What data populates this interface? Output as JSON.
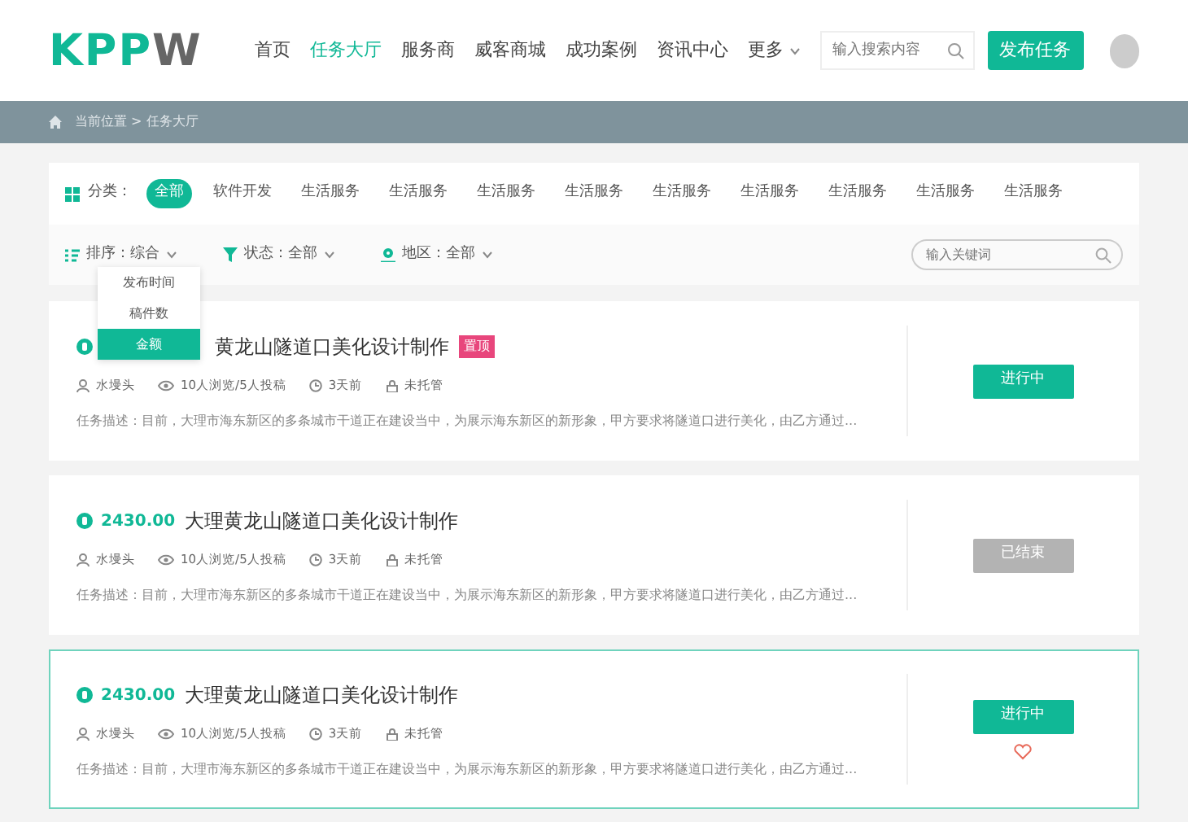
{
  "header": {
    "logo": "KPPW",
    "nav": [
      {
        "label": "首页",
        "selected": false
      },
      {
        "label": "任务大厅",
        "selected": true
      },
      {
        "label": "服务商",
        "selected": false
      },
      {
        "label": "威客商城",
        "selected": false
      },
      {
        "label": "成功案例",
        "selected": false
      },
      {
        "label": "资讯中心",
        "selected": false
      },
      {
        "label": "更多",
        "selected": false,
        "dropdown": true
      }
    ],
    "search": {
      "placeholder": "输入搜索内容"
    },
    "publish_button": "发布任务"
  },
  "breadcrumb": "当前位置 > 任务大厅",
  "filters": {
    "category_label": "分类：",
    "categories": [
      {
        "label": "全部",
        "selected": true
      },
      {
        "label": "软件开发",
        "selected": false
      },
      {
        "label": "生活服务",
        "selected": false
      },
      {
        "label": "生活服务",
        "selected": false
      },
      {
        "label": "生活服务",
        "selected": false
      },
      {
        "label": "生活服务",
        "selected": false
      },
      {
        "label": "生活服务",
        "selected": false
      },
      {
        "label": "生活服务",
        "selected": false
      },
      {
        "label": "生活服务",
        "selected": false
      },
      {
        "label": "生活服务",
        "selected": false
      },
      {
        "label": "生活服务",
        "selected": false
      }
    ],
    "dropdowns": [
      {
        "kind": "sort",
        "label": "排序：综合"
      },
      {
        "kind": "status",
        "label": "状态：全部"
      },
      {
        "kind": "region",
        "label": "地区：全部"
      }
    ],
    "keyword": {
      "placeholder": "输入关键词"
    },
    "sort_menu": [
      {
        "label": "发布时间",
        "selected": false
      },
      {
        "label": "稿件数",
        "selected": false
      },
      {
        "label": "金额",
        "selected": true
      }
    ]
  },
  "tasks": [
    {
      "title": "黄龙山隧道口美化设计制作",
      "badge": "置顶",
      "author": "水墁头",
      "views": "10人浏览/5人投稿",
      "time": "3天前",
      "escrow": "未托管",
      "description": "任务描述：目前，大理市海东新区的多条城市干道正在建设当中，为展示海东新区的新形象，甲方要求将隧道口进行美化，由乙方通过...",
      "status": "进行中",
      "ended": false,
      "highlighted": false,
      "favorite": false
    },
    {
      "price": "2430.00",
      "title": "大理黄龙山隧道口美化设计制作",
      "author": "水墁头",
      "views": "10人浏览/5人投稿",
      "time": "3天前",
      "escrow": "未托管",
      "description": "任务描述：目前，大理市海东新区的多条城市干道正在建设当中，为展示海东新区的新形象，甲方要求将隧道口进行美化，由乙方通过...",
      "status": "已结束",
      "ended": true,
      "highlighted": false,
      "favorite": false
    },
    {
      "price": "2430.00",
      "title": "大理黄龙山隧道口美化设计制作",
      "author": "水墁头",
      "views": "10人浏览/5人投稿",
      "time": "3天前",
      "escrow": "未托管",
      "description": "任务描述：目前，大理市海东新区的多条城市干道正在建设当中，为展示海东新区的新形象，甲方要求将隧道口进行美化，由乙方通过...",
      "status": "进行中",
      "ended": false,
      "highlighted": true,
      "favorite": true
    }
  ]
}
